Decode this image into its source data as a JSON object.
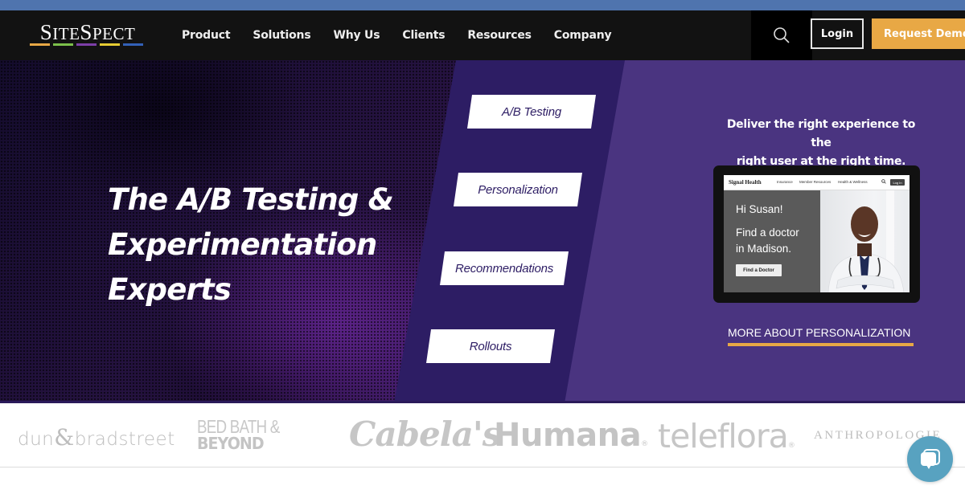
{
  "brand": {
    "name_first": "S",
    "name_rest1": "ITE",
    "name_mid": "S",
    "name_rest2": "PECT",
    "bar_colors": [
      "#e8a845",
      "#7cc04b",
      "#7d3fa8",
      "#e6cc33",
      "#3361b8"
    ]
  },
  "nav": {
    "items": [
      {
        "label": "Product"
      },
      {
        "label": "Solutions"
      },
      {
        "label": "Why Us"
      },
      {
        "label": "Clients"
      },
      {
        "label": "Resources"
      },
      {
        "label": "Company"
      }
    ],
    "search_icon": "search-icon",
    "login_label": "Login",
    "demo_label": "Request Demo"
  },
  "hero": {
    "headline_lines": [
      "The A/B Testing &",
      "Experimentation",
      "Experts"
    ],
    "pills": [
      {
        "label": "A/B Testing"
      },
      {
        "label": "Personalization"
      },
      {
        "label": "Recommendations"
      },
      {
        "label": "Rollouts"
      }
    ],
    "tagline_lines": [
      "Deliver the right experience to the",
      "right user at the right time."
    ],
    "mockup": {
      "brand": "Signal Health",
      "links": [
        "Insurance",
        "Member Resources",
        "Health & Wellness"
      ],
      "login": "Log In",
      "greeting": "Hi Susan!",
      "message_lines": [
        "Find a doctor",
        "in Madison."
      ],
      "button": "Find a Doctor"
    },
    "more_link": "MORE ABOUT PERSONALIZATION"
  },
  "clients": {
    "dnb": {
      "left": "dun",
      "amp": "&",
      "right": "bradstreet"
    },
    "bbb": {
      "line1": "BED BATH &",
      "line2": "BEYOND"
    },
    "cabelas": "Cabela's",
    "humana": "Humana",
    "humana_mark": "®",
    "teleflora": "teleflora",
    "teleflora_mark": "®",
    "anthropologie": "ANTHROPOLOGIE"
  },
  "colors": {
    "accent_gold": "#e8a845",
    "hero_purple": "#4a3480",
    "hero_deep_purple": "#2d1d64",
    "chat_blue": "#58a2c0"
  }
}
